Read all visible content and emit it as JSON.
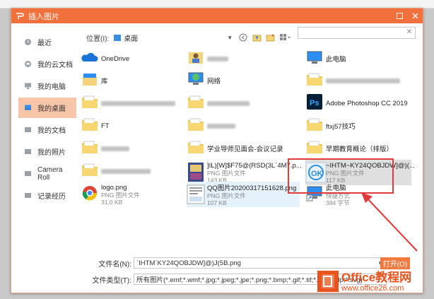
{
  "window": {
    "title": "插入图片"
  },
  "sidebar": {
    "items": [
      {
        "label": "最近",
        "icon": "clock-icon",
        "active": false
      },
      {
        "label": "我的云文档",
        "icon": "cloud-icon",
        "active": false
      },
      {
        "label": "我的电脑",
        "icon": "computer-icon",
        "active": false
      },
      {
        "label": "我的桌面",
        "icon": "desktop-icon",
        "active": true
      },
      {
        "label": "我的文档",
        "icon": "folder-icon",
        "active": false
      },
      {
        "label": "我的照片",
        "icon": "folder-icon",
        "active": false
      },
      {
        "label": "Camera Roll",
        "icon": "folder-icon",
        "active": false
      },
      {
        "label": "记录经历",
        "icon": "folder-icon",
        "active": false
      }
    ]
  },
  "toolbar": {
    "location_label": "位置(I):",
    "location_value": "桌面"
  },
  "files": [
    {
      "name": "OneDrive",
      "type": "",
      "size": "",
      "icon": "cloud-icon"
    },
    {
      "name": "",
      "type": "",
      "size": "",
      "icon": "user-folder-icon"
    },
    {
      "name": "此电脑",
      "type": "",
      "size": "",
      "icon": "computer-icon"
    },
    {
      "name": "库",
      "type": "",
      "size": "",
      "icon": "library-icon"
    },
    {
      "name": "网络",
      "type": "",
      "size": "",
      "icon": "network-icon"
    },
    {
      "name": "",
      "type": "",
      "size": "",
      "icon": "folder-icon"
    },
    {
      "name": "",
      "type": "",
      "size": "",
      "icon": "folder-icon"
    },
    {
      "name": "",
      "type": "",
      "size": "",
      "icon": "folder-icon"
    },
    {
      "name": "Adobe Photoshop CC 2019",
      "type": "",
      "size": "",
      "icon": "photoshop-icon"
    },
    {
      "name": "FT",
      "type": "",
      "size": "",
      "icon": "folder-icon"
    },
    {
      "name": "",
      "type": "",
      "size": "",
      "icon": "folder-icon"
    },
    {
      "name": "ftxj57技巧",
      "type": "",
      "size": "",
      "icon": "folder-icon"
    },
    {
      "name": "",
      "type": "",
      "size": "",
      "icon": "folder-icon"
    },
    {
      "name": "学业导师见面会-会议记录",
      "type": "",
      "size": "",
      "icon": "folder-icon"
    },
    {
      "name": "早期教育概论（排版）",
      "type": "",
      "size": "",
      "icon": "folder-icon"
    },
    {
      "name": "",
      "type": "",
      "size": "",
      "icon": "folder-icon"
    },
    {
      "name": "]IL)[W]$F75@(RSD(3L`4M7.p...",
      "type": "PNG 图片文件",
      "size": "143 KB",
      "icon": "image-icon"
    },
    {
      "name": "~IHTM~KY24QOBJDW]@)(...",
      "type": "PNG 图片文件",
      "size": "117 KB",
      "icon": "ok-image-icon"
    },
    {
      "name": "logo.png",
      "type": "PNG 图片文件",
      "size": "31.0 KB",
      "icon": "chrome-logo-icon"
    },
    {
      "name": "QQ图片20200317151628.png",
      "type": "PNG 图片文件",
      "size": "107 KB",
      "icon": "document-image-icon"
    },
    {
      "name": "此电脑",
      "type": "快捷方式",
      "size": "384 字节",
      "icon": "computer-shortcut-icon"
    }
  ],
  "bottom": {
    "filename_label": "文件名(N):",
    "filename_value": "`IHTM`KY24QOBJDW]@)J(5B.png",
    "filetype_label": "文件类型(T):",
    "filetype_value": "所有图片(*.emf;*.wmf;*.jpg;*.jpeg;*.jpe;*.png;*.bmp;*.gif;*.tif;*.tiff;*.wdp;*.svg)",
    "open_label": "打开(O)"
  },
  "watermark": {
    "line1": "Office教程网",
    "line2": "www.office26.com"
  },
  "colors": {
    "accent": "#f2703c",
    "sidebar_active": "#f8c5a9",
    "annotation": "#e03a3a"
  }
}
